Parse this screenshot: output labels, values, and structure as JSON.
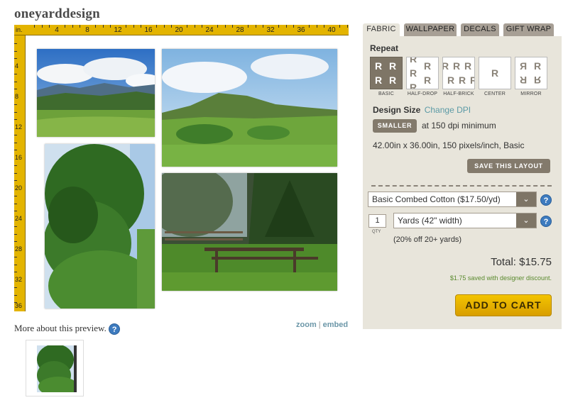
{
  "shop": {
    "name": "oneyarddesign"
  },
  "ruler": {
    "unit": "in.",
    "top_labels": [
      "4",
      "8",
      "12",
      "16",
      "20",
      "24",
      "28",
      "32",
      "36",
      "40"
    ],
    "left_labels": [
      "4",
      "8",
      "12",
      "16",
      "20",
      "24",
      "28",
      "32",
      "36"
    ],
    "color": "#e3b400"
  },
  "preview": {
    "more_about": "More about this preview.",
    "zoom": "zoom",
    "embed": "embed",
    "separator": "|"
  },
  "tabs": [
    {
      "label": "FABRIC",
      "active": true
    },
    {
      "label": "WALLPAPER",
      "active": false
    },
    {
      "label": "DECALS",
      "active": false
    },
    {
      "label": "GIFT WRAP",
      "active": false
    }
  ],
  "repeat": {
    "label": "Repeat",
    "options": [
      {
        "caption": "BASIC",
        "selected": true
      },
      {
        "caption": "HALF-DROP",
        "selected": false
      },
      {
        "caption": "HALF-BRICK",
        "selected": false
      },
      {
        "caption": "CENTER",
        "selected": false
      },
      {
        "caption": "MIRROR",
        "selected": false
      }
    ]
  },
  "design_size": {
    "label": "Design Size",
    "change_dpi": "Change DPI",
    "smaller_button": "SMALLER",
    "dpi_text": "at 150 dpi minimum",
    "dimensions": "42.00in x 36.00in, 150 pixels/inch, Basic",
    "save_layout_button": "SAVE THIS LAYOUT"
  },
  "purchase": {
    "fabric_select": "Basic Combed Cotton ($17.50/yd)",
    "quantity": "1",
    "qty_label": "QTY",
    "unit_select": "Yards (42\" width)",
    "discount_note": "(20% off 20+ yards)",
    "total": "Total: $15.75",
    "saved_note": "$1.75 saved with designer discount.",
    "add_to_cart": "ADD TO CART",
    "help": "?",
    "chevron": "⌄"
  },
  "colors": {
    "accent": "#e3b400",
    "panel_bg": "#e8e5db",
    "button_gray": "#837a6c",
    "link_teal": "#5b9aa6",
    "cart_yellow": "#f3c400",
    "saved_green": "#5a8a2e"
  }
}
